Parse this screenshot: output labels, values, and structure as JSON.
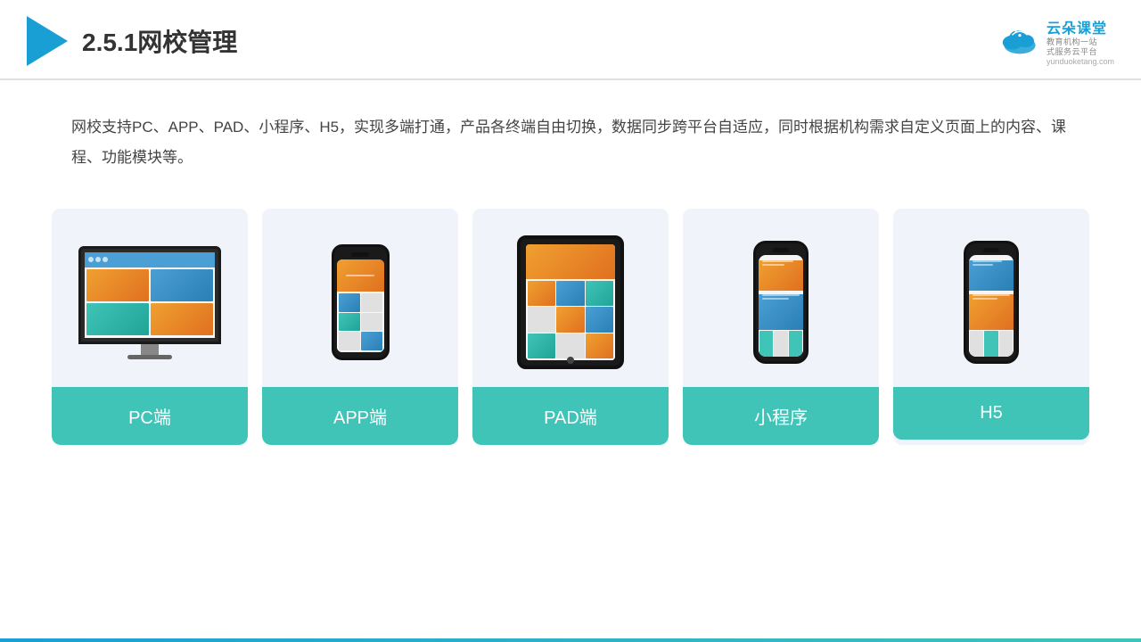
{
  "header": {
    "title": "2.5.1网校管理",
    "title_num": "2.5.1",
    "title_main": "网校管理"
  },
  "brand": {
    "name": "云朵课堂",
    "sub1": "教育机构一站",
    "sub2": "式服务云平台",
    "url": "yunduoketang.com"
  },
  "description": {
    "text": "网校支持PC、APP、PAD、小程序、H5，实现多端打通，产品各终端自由切换，数据同步跨平台自适应，同时根据机构需求自定义页面上的内容、课程、功能模块等。"
  },
  "cards": [
    {
      "id": "pc",
      "label": "PC端"
    },
    {
      "id": "app",
      "label": "APP端"
    },
    {
      "id": "pad",
      "label": "PAD端"
    },
    {
      "id": "miniprogram",
      "label": "小程序"
    },
    {
      "id": "h5",
      "label": "H5"
    }
  ],
  "colors": {
    "accent": "#1a9fd4",
    "teal": "#40c4b8",
    "background_card": "#f0f4fa",
    "label_bg": "#40c4b8"
  }
}
